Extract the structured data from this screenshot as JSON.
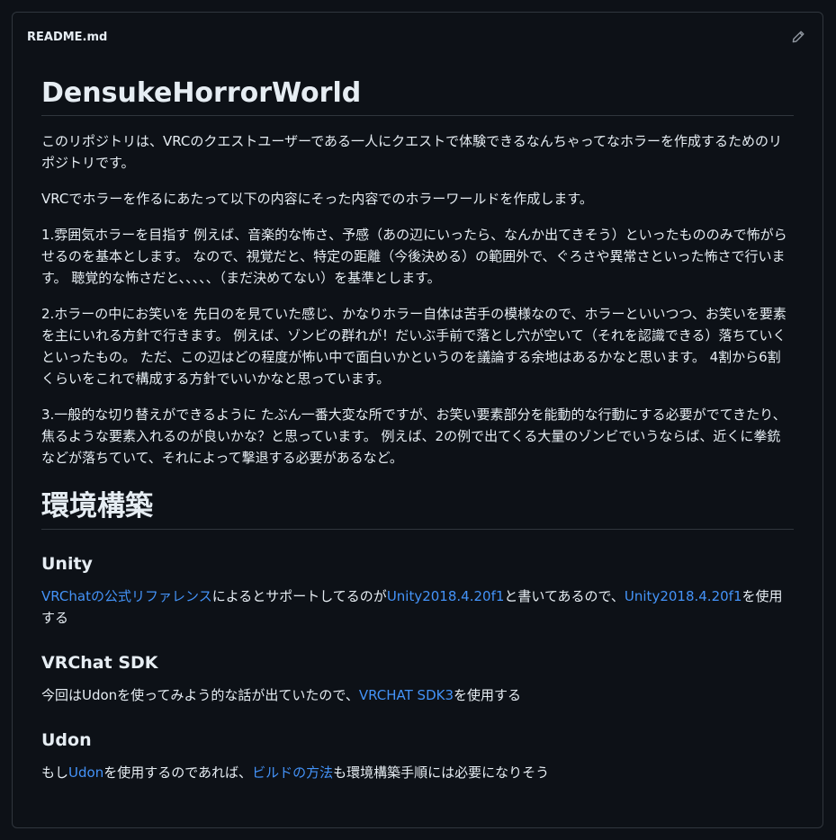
{
  "file": {
    "name": "README.md",
    "edit_icon": "pencil-icon"
  },
  "readme": {
    "title": "DensukeHorrorWorld",
    "intro": "このリポジトリは、VRCのクエストユーザーである一人にクエストで体験できるなんちゃってなホラーを作成するためのリポジトリです。",
    "policy_lead": "VRCでホラーを作るにあたって以下の内容にそった内容でのホラーワールドを作成します。",
    "point1": "1.雰囲気ホラーを目指す 例えば、音楽的な怖さ、予感（あの辺にいったら、なんか出てきそう）といったもののみで怖がらせるのを基本とします。 なので、視覚だと、特定の距離（今後決める）の範囲外で、ぐろさや異常さといった怖さで行います。 聴覚的な怖さだと、、、、、（まだ決めてない）を基準とします。",
    "point2": "2.ホラーの中にお笑いを 先日のを見ていた感じ、かなりホラー自体は苦手の模様なので、ホラーといいつつ、お笑いを要素を主にいれる方針で行きます。 例えば、ゾンビの群れが！だいぶ手前で落とし穴が空いて（それを認識できる）落ちていくといったもの。 ただ、この辺はどの程度が怖い中で面白いかというのを議論する余地はあるかなと思います。 4割から6割くらいをこれで構成する方針でいいかなと思っています。",
    "point3": "3.一般的な切り替えができるように たぶん一番大変な所ですが、お笑い要素部分を能動的な行動にする必要がでてきたり、焦るような要素入れるのが良いかな？と思っています。 例えば、2の例で出てくる大量のゾンビでいうならば、近くに拳銃などが落ちていて、それによって撃退する必要があるなど。",
    "env_heading": "環境構築",
    "unity": {
      "heading": "Unity",
      "link1": "VRChatの公式リファレンス",
      "text1": "によるとサポートしてるのが",
      "link2": "Unity2018.4.20f1",
      "text2": "と書いてあるので、",
      "link3": "Unity2018.4.20f1",
      "text3": "を使用する"
    },
    "sdk": {
      "heading": "VRChat SDK",
      "text1": "今回はUdonを使ってみよう的な話が出ていたので、",
      "link1": "VRCHAT SDK3",
      "text2": "を使用する"
    },
    "udon": {
      "heading": "Udon",
      "text1": "もし",
      "link1": "Udon",
      "text2": "を使用するのであれば、",
      "link2": "ビルドの方法",
      "text3": "も環境構築手順には必要になりそう"
    }
  },
  "colors": {
    "background": "#0d1117",
    "border": "#30363d",
    "text": "#e6edf3",
    "link": "#4493f8"
  }
}
